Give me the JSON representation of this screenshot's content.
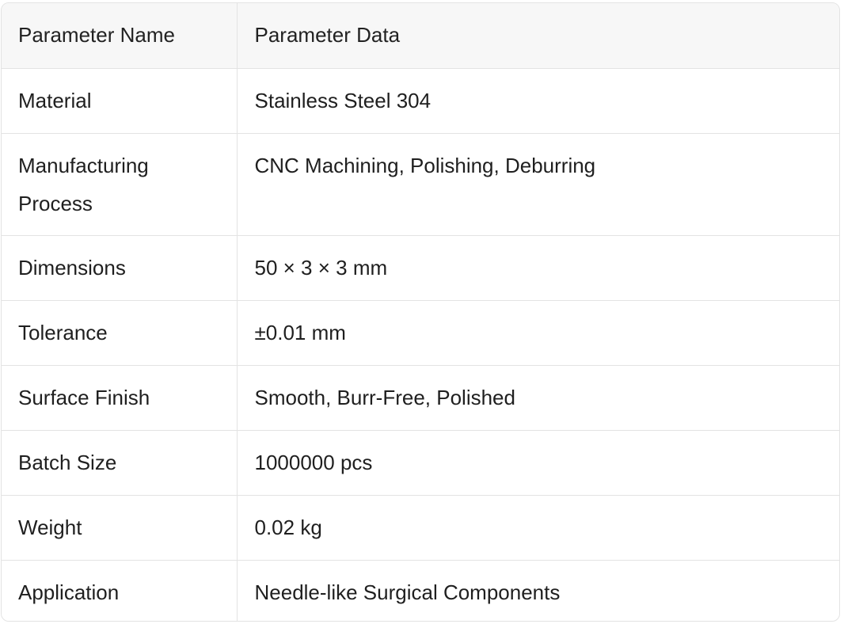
{
  "table": {
    "headers": {
      "name": "Parameter Name",
      "value": "Parameter Data"
    },
    "rows": [
      {
        "name": "Material",
        "value": "Stainless Steel 304"
      },
      {
        "name": "Manufacturing Process",
        "value": "CNC Machining, Polishing, Deburring"
      },
      {
        "name": "Dimensions",
        "value": "50 × 3 × 3 mm"
      },
      {
        "name": "Tolerance",
        "value": "±0.01 mm"
      },
      {
        "name": "Surface Finish",
        "value": "Smooth, Burr-Free, Polished"
      },
      {
        "name": "Batch Size",
        "value": "1000000 pcs"
      },
      {
        "name": "Weight",
        "value": "0.02 kg"
      },
      {
        "name": "Application",
        "value": "Needle-like Surgical Components"
      }
    ]
  }
}
